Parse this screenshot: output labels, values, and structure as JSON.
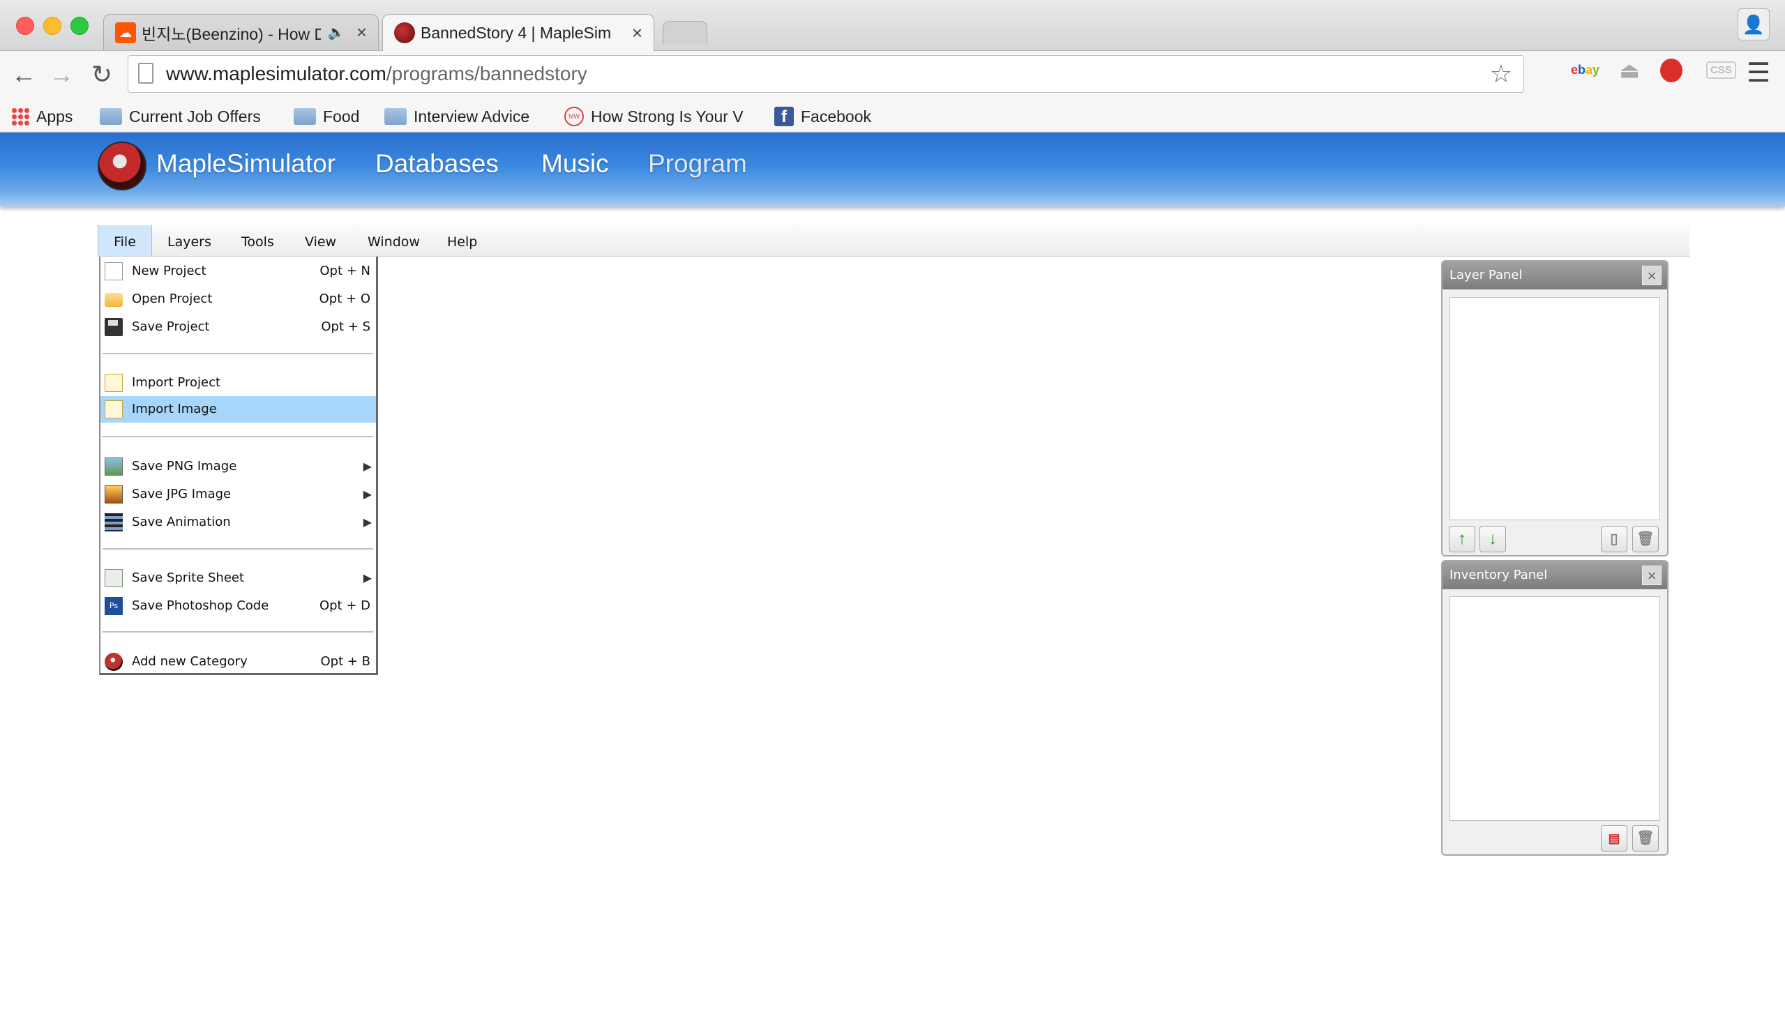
{
  "browser": {
    "tabs": [
      {
        "title": "빈지노(Beenzino) - How D",
        "favicon": "soundcloud-icon",
        "audio": true
      },
      {
        "title": "BannedStory 4 | MapleSim",
        "favicon": "maplesimulator-icon"
      }
    ],
    "url_host": "www.maplesimulator.com",
    "url_path": "/programs/bannedstory",
    "extensions": [
      "ebay",
      "CSS"
    ],
    "bookmarks": [
      "Apps",
      "Current Job Offers",
      "Food",
      "Interview Advice",
      "How Strong Is Your V",
      "Facebook"
    ]
  },
  "site": {
    "name": "MapleSimulator",
    "nav": [
      "Databases",
      "Music",
      "Program"
    ]
  },
  "app": {
    "menubar": [
      "File",
      "Layers",
      "Tools",
      "View",
      "Window",
      "Help"
    ],
    "file_menu": [
      {
        "label": "New Project",
        "shortcut": "Opt + N",
        "icon": "new-document-icon"
      },
      {
        "label": "Open Project",
        "shortcut": "Opt + O",
        "icon": "open-folder-icon"
      },
      {
        "label": "Save Project",
        "shortcut": "Opt + S",
        "icon": "floppy-disk-icon"
      },
      {
        "label": "Import Project",
        "shortcut": "",
        "icon": "import-project-icon"
      },
      {
        "label": "Import Image",
        "shortcut": "",
        "icon": "import-image-icon",
        "highlighted": true
      },
      {
        "label": "Save PNG Image",
        "submenu": true,
        "icon": "png-image-icon"
      },
      {
        "label": "Save JPG Image",
        "submenu": true,
        "icon": "jpg-image-icon"
      },
      {
        "label": "Save Animation",
        "submenu": true,
        "icon": "film-strip-icon"
      },
      {
        "label": "Save Sprite Sheet",
        "submenu": true,
        "icon": "sprite-sheet-icon"
      },
      {
        "label": "Save Photoshop Code",
        "shortcut": "Opt + D",
        "icon": "photoshop-icon"
      },
      {
        "label": "Add new Category",
        "shortcut": "Opt + B",
        "icon": "add-category-icon"
      }
    ],
    "layer_panel": {
      "title": "Layer Panel"
    },
    "inventory_panel": {
      "title": "Inventory Panel"
    }
  }
}
